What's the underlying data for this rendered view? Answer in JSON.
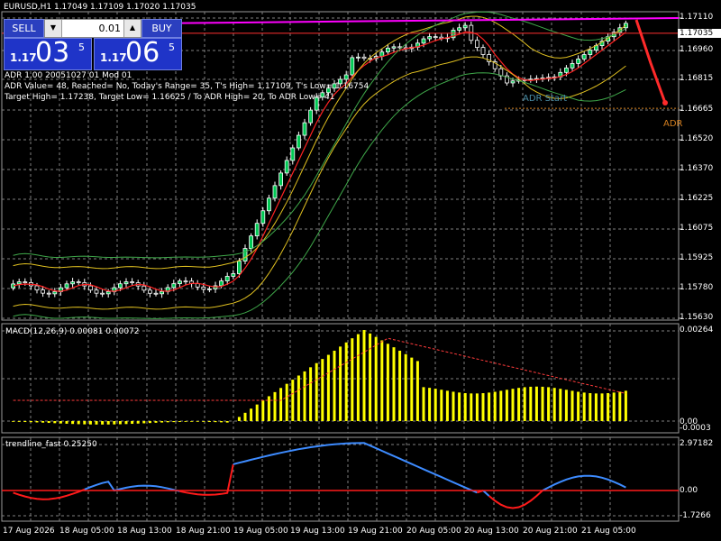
{
  "header": {
    "symbol_line": "EURUSD,H1  1.17049 1.17109 1.17020 1.17035"
  },
  "trade_panel": {
    "sell_label": "SELL",
    "buy_label": "BUY",
    "lot_value": "0.01",
    "bid_small": "1.17",
    "bid_big": "03",
    "bid_sup": "5",
    "ask_small": "1.17",
    "ask_big": "06",
    "ask_sup": "5"
  },
  "info": {
    "line1": "ADR 1.00 20051027 01 Mod 01",
    "line2": "ADR Value= 48, Reached= No, Today's Range= 35, T's High= 1.17109, T's Low= 1.16754",
    "line3": "Target High= 1.17238, Target Low= 1.16625 / To ADR High= 20, To ADR Low= 41"
  },
  "annotations": {
    "adr_start": "ADR Start",
    "adr_right": "ADR"
  },
  "colors": {
    "bull": "#ffffff",
    "bear": "#ffffff",
    "bull_fill": "#00c853",
    "bear_fill": "#000000",
    "macd_hist": "#ffff00",
    "macd_signal": "#ff3b3b",
    "trend_up": "#3d8bff",
    "trend_down": "#ff1a1a",
    "adr_high": "#ff00ff",
    "target_line": "#ff2a2a",
    "grid": "#808080"
  },
  "price_axis": [
    {
      "label": "1.17110"
    },
    {
      "label": "1.17035"
    },
    {
      "label": "1.16960"
    },
    {
      "label": "1.16815"
    },
    {
      "label": "1.16665"
    },
    {
      "label": "1.16520"
    },
    {
      "label": "1.16370"
    },
    {
      "label": "1.16225"
    },
    {
      "label": "1.16075"
    },
    {
      "label": "1.15925"
    },
    {
      "label": "1.15780"
    },
    {
      "label": "1.15630"
    }
  ],
  "macd": {
    "label": "MACD(12,26,9) 0.00081 0.00072",
    "axis_top": "0.00264",
    "axis_zero": "0.00",
    "axis_bottom": "-0.0003"
  },
  "trendline": {
    "label": "trendline_fast 0.25250",
    "axis_top": "2.97182",
    "axis_zero": "0.00",
    "axis_bottom": "-1.7266"
  },
  "time_axis": [
    "17 Aug 2026",
    "18 Aug 05:00",
    "18 Aug 13:00",
    "18 Aug 21:00",
    "19 Aug 05:00",
    "19 Aug 13:00",
    "19 Aug 21:00",
    "20 Aug 05:00",
    "20 Aug 13:00",
    "20 Aug 21:00",
    "21 Aug 05:00"
  ]
}
